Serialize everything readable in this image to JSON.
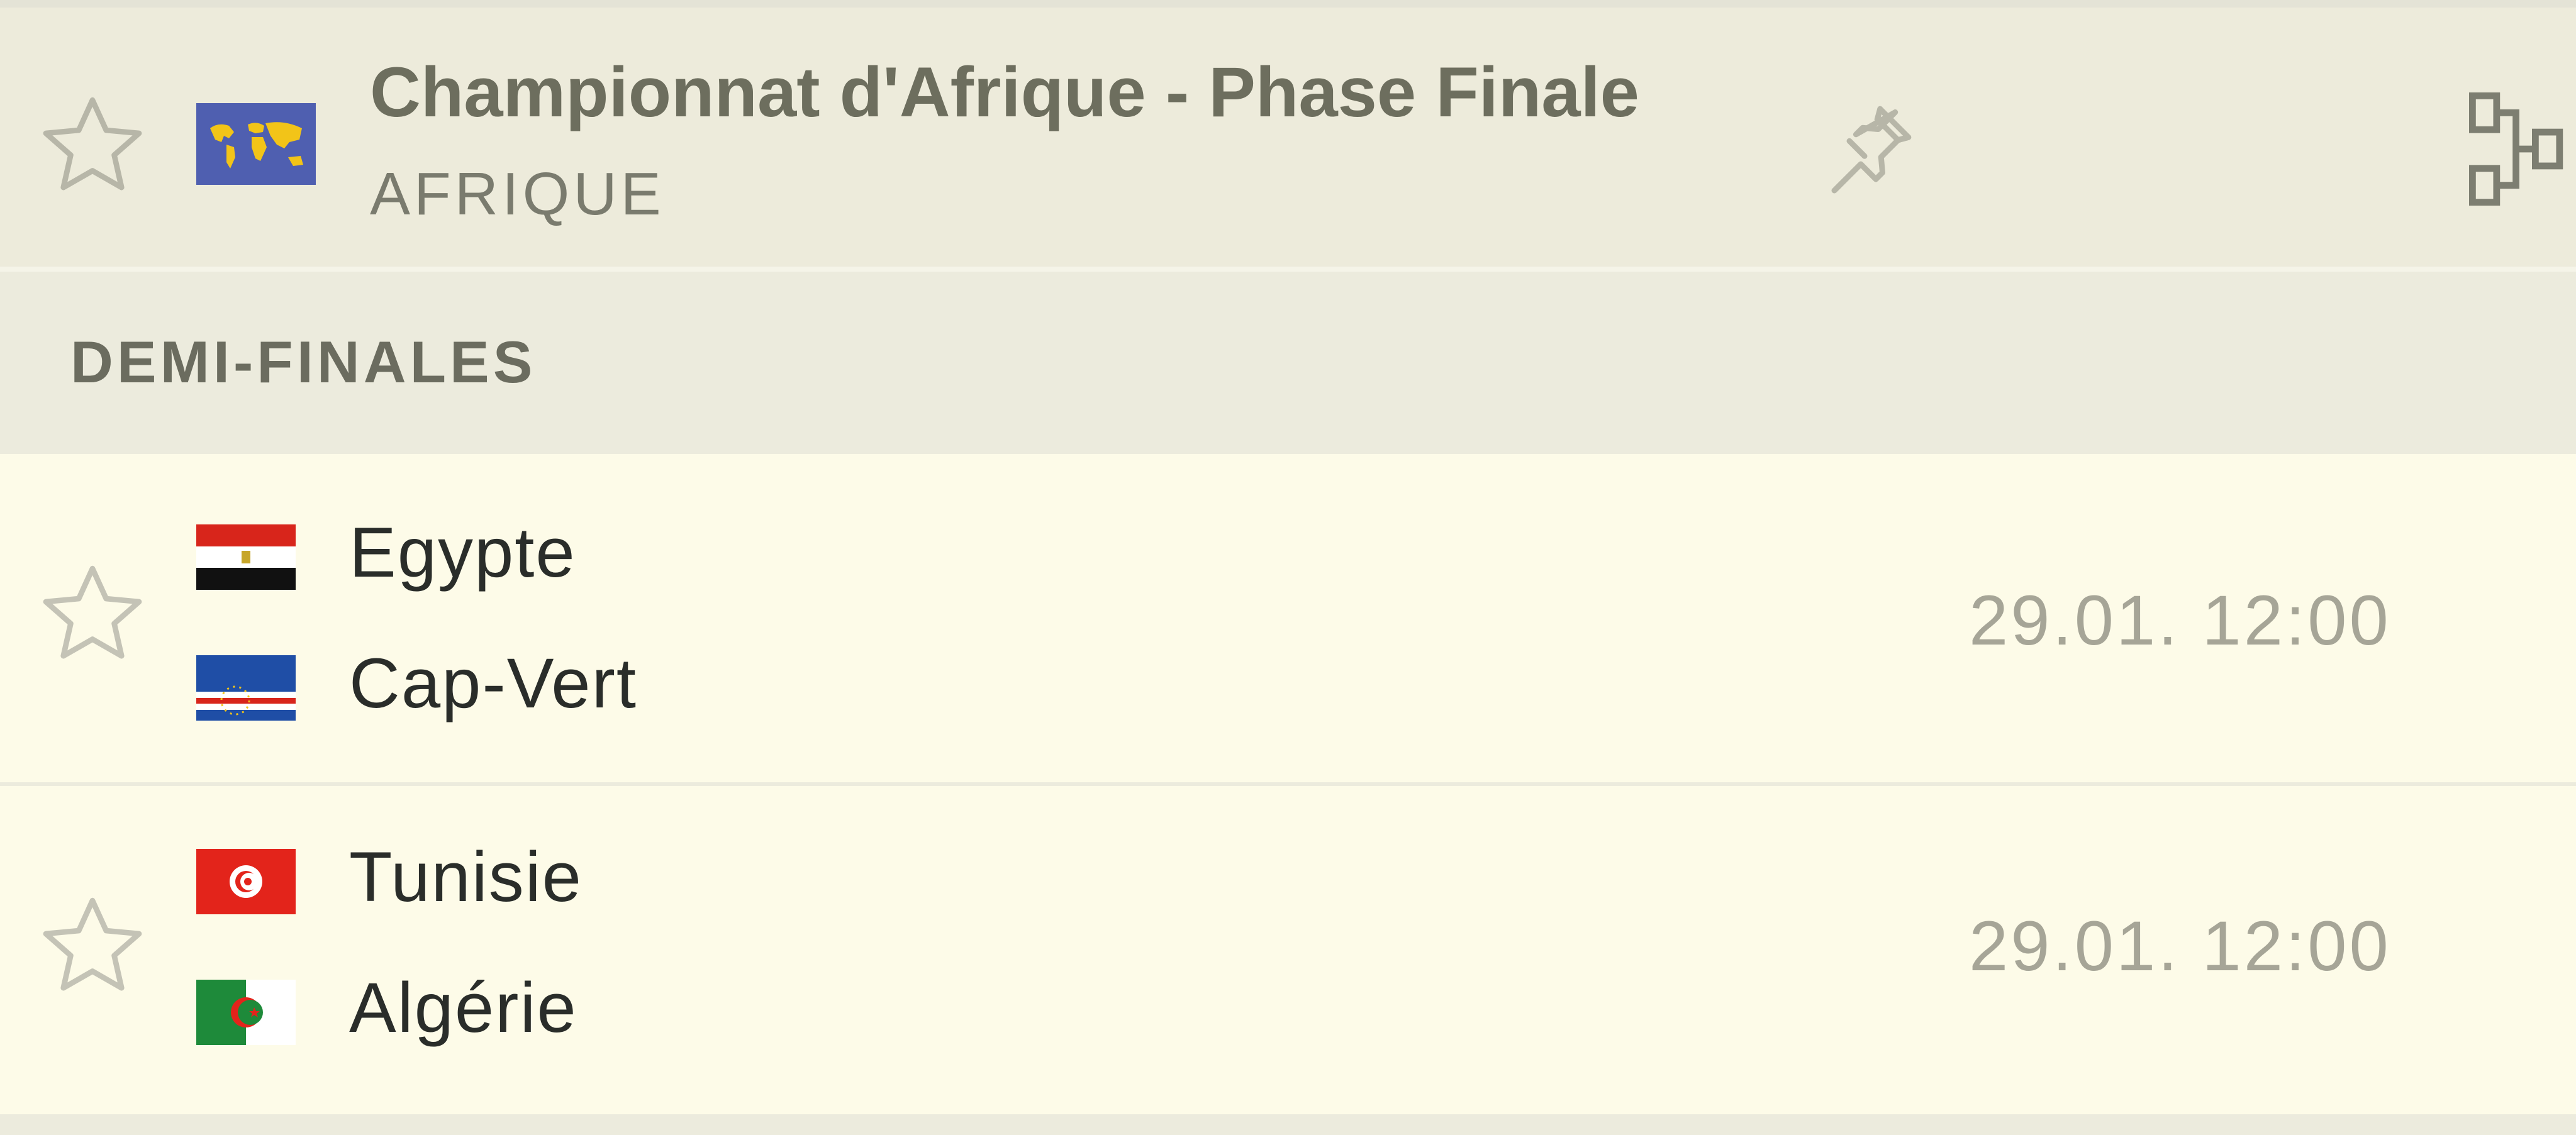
{
  "league": {
    "title": "Championnat d'Afrique - Phase Finale",
    "country": "AFRIQUE",
    "icons": {
      "favorite": "star-outline-icon",
      "flag": "world-flag-icon",
      "pin": "pin-icon",
      "bracket": "bracket-icon"
    }
  },
  "round": {
    "title": "DEMI-FINALES"
  },
  "matches": [
    {
      "home": "Egypte",
      "away": "Cap-Vert",
      "home_flag": "egypt-flag-icon",
      "away_flag": "cape-verde-flag-icon",
      "time": "29.01. 12:00"
    },
    {
      "home": "Tunisie",
      "away": "Algérie",
      "home_flag": "tunisia-flag-icon",
      "away_flag": "algeria-flag-icon",
      "time": "29.01. 12:00"
    }
  ],
  "colors": {
    "header_bg": "#edebdb",
    "row_bg": "#fdfbe8",
    "title_text": "#6d6e5e",
    "team_text": "#2a2d2a",
    "time_text": "#a6a597"
  }
}
